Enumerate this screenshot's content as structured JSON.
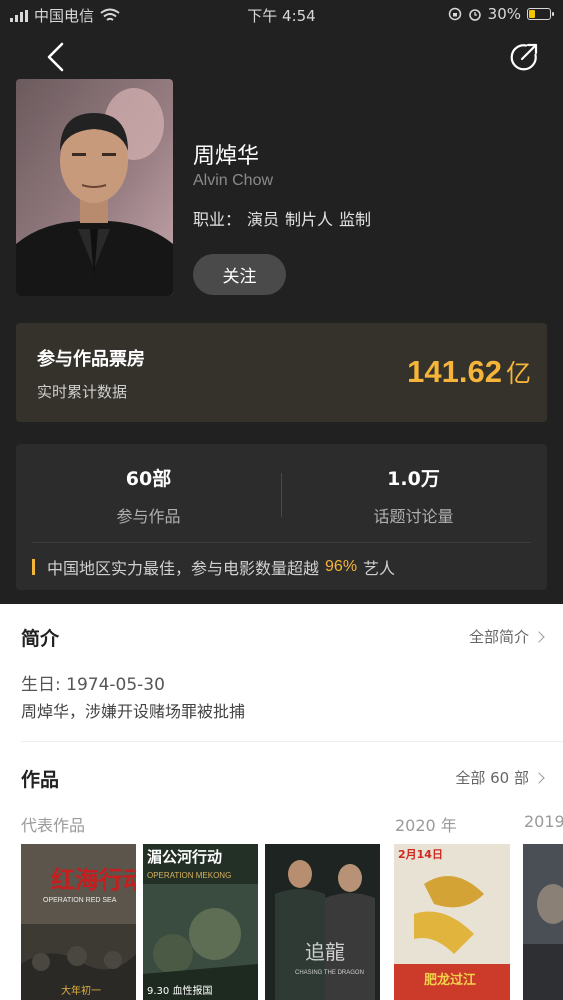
{
  "status_bar": {
    "carrier": "中国电信",
    "time": "下午 4:54",
    "battery": "30%",
    "battery_level": 0.3
  },
  "header": {
    "back_icon": "chevron-left-icon",
    "share_icon": "share-icon"
  },
  "profile": {
    "name": "周焯华",
    "english_name": "Alvin Chow",
    "job_label": "职业：",
    "jobs": [
      "演员",
      "制片人",
      "监制"
    ],
    "follow_label": "关注"
  },
  "box_office": {
    "title": "参与作品票房",
    "subtitle": "实时累计数据",
    "value": "141.62",
    "unit": "亿",
    "accent": "#f5b53a"
  },
  "stats": {
    "works_value": "60部",
    "works_label": "参与作品",
    "discussion_value": "1.0万",
    "discussion_label": "话题讨论量",
    "claim_before": "中国地区实力最佳，参与电影数量超越",
    "claim_pct": "96%",
    "claim_after": "艺人"
  },
  "intro": {
    "title": "简介",
    "more_label": "全部简介",
    "birth": "生日: 1974-05-30",
    "text": "周焯华，涉嫌开设赌场罪被批捕"
  },
  "works": {
    "title": "作品",
    "more_label": "全部 60 部",
    "groups": [
      "代表作品",
      "2020 年",
      "2019"
    ],
    "posters": [
      {
        "title": "红海行动",
        "subtitle": "OPERATION RED SEA",
        "tag": "大年初一"
      },
      {
        "title": "湄公河行动",
        "subtitle": "OPERATION MEKONG",
        "tag": "9.30 血性报国"
      },
      {
        "title": "追龍",
        "subtitle": "CHASING THE DRAGON",
        "tag": ""
      },
      {
        "title": "肥龙过江",
        "subtitle": "2月14日",
        "tag": "肥龙过江"
      },
      {
        "title": "",
        "subtitle": "",
        "tag": ""
      }
    ]
  }
}
